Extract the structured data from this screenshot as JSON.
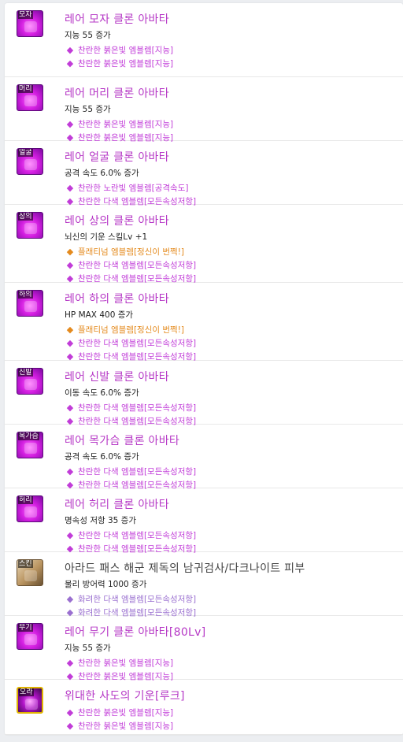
{
  "colors": {
    "rare_title": "#b638c6",
    "pink_emblem": "#c13cd8",
    "orange_emblem": "#e48a1d",
    "violet_emblem": "#9a6fd0"
  },
  "items": [
    {
      "icon": "hat-avatar-icon",
      "slot_tag": "모자",
      "title": "레어 모자 클론 아바타",
      "stat": "지능 55 증가",
      "emblems": [
        {
          "text": "찬란한 붉은빛 엠블렘[지능]",
          "gem": "pink"
        },
        {
          "text": "찬란한 붉은빛 엠블렘[지능]",
          "gem": "pink"
        }
      ]
    },
    {
      "icon": "hair-avatar-icon",
      "slot_tag": "머리",
      "title": "레어 머리 클론 아바타",
      "stat": "지능 55 증가",
      "emblems": [
        {
          "text": "찬란한 붉은빛 엠블렘[지능]",
          "gem": "pink"
        },
        {
          "text": "찬란한 붉은빛 엠블렘[지능]",
          "gem": "pink"
        }
      ]
    },
    {
      "icon": "face-avatar-icon",
      "slot_tag": "얼굴",
      "title": "레어 얼굴 클론 아바타",
      "stat": "공격 속도 6.0% 증가",
      "emblems": [
        {
          "text": "찬란한 노란빛 엠블렘[공격속도]",
          "gem": "pink"
        },
        {
          "text": "찬란한 다색 엠블렘[모든속성저항]",
          "gem": "pink"
        }
      ]
    },
    {
      "icon": "top-avatar-icon",
      "slot_tag": "상의",
      "title": "레어 상의 클론 아바타",
      "stat": "뇌신의 기운 스킬Lv +1",
      "emblems": [
        {
          "text": "플래티넘 엠블렘[정신이 번쩍!]",
          "gem": "orange"
        },
        {
          "text": "찬란한 다색 엠블렘[모든속성저항]",
          "gem": "pink"
        },
        {
          "text": "찬란한 다색 엠블렘[모든속성저항]",
          "gem": "pink"
        }
      ]
    },
    {
      "icon": "bottom-avatar-icon",
      "slot_tag": "하의",
      "title": "레어 하의 클론 아바타",
      "stat": "HP MAX 400 증가",
      "emblems": [
        {
          "text": "플래티넘 엠블렘[정신이 번쩍!]",
          "gem": "orange"
        },
        {
          "text": "찬란한 다색 엠블렘[모든속성저항]",
          "gem": "pink"
        },
        {
          "text": "찬란한 다색 엠블렘[모든속성저항]",
          "gem": "pink"
        }
      ]
    },
    {
      "icon": "shoes-avatar-icon",
      "slot_tag": "신발",
      "title": "레어 신발 클론 아바타",
      "stat": "이동 속도 6.0% 증가",
      "emblems": [
        {
          "text": "찬란한 다색 엠블렘[모든속성저항]",
          "gem": "pink"
        },
        {
          "text": "찬란한 다색 엠블렘[모든속성저항]",
          "gem": "pink"
        }
      ]
    },
    {
      "icon": "neck-avatar-icon",
      "slot_tag": "목가슴",
      "title": "레어 목가슴 클론 아바타",
      "stat": "공격 속도 6.0% 증가",
      "emblems": [
        {
          "text": "찬란한 다색 엠블렘[모든속성저항]",
          "gem": "pink"
        },
        {
          "text": "찬란한 다색 엠블렘[모든속성저항]",
          "gem": "pink"
        }
      ]
    },
    {
      "icon": "belt-avatar-icon",
      "slot_tag": "허리",
      "title": "레어 허리 클론 아바타",
      "stat": "명속성 저항 35 증가",
      "emblems": [
        {
          "text": "찬란한 다색 엠블렘[모든속성저항]",
          "gem": "pink"
        },
        {
          "text": "찬란한 다색 엠블렘[모든속성저항]",
          "gem": "pink"
        }
      ]
    },
    {
      "icon": "skin-avatar-icon",
      "slot_tag": "스킨",
      "title": "아라드 패스 해군 제독의 남귀검사/다크나이트 피부",
      "stat": "물리 방어력 1000 증가",
      "emblems": [
        {
          "text": "화려한 다색 엠블렘[모든속성저항]",
          "gem": "violet"
        },
        {
          "text": "화려한 다색 엠블렘[모든속성저항]",
          "gem": "violet"
        }
      ]
    },
    {
      "icon": "weapon-avatar-icon",
      "slot_tag": "무기",
      "title": "레어 무기 클론 아바타[80Lv]",
      "stat": "지능 55 증가",
      "emblems": [
        {
          "text": "찬란한 붉은빛 엠블렘[지능]",
          "gem": "pink"
        },
        {
          "text": "찬란한 붉은빛 엠블렘[지능]",
          "gem": "pink"
        }
      ]
    },
    {
      "icon": "aura-avatar-icon",
      "slot_tag": "오라",
      "title": "위대한 사도의 기운[루크]",
      "stat": "",
      "emblems": [
        {
          "text": "찬란한 붉은빛 엠블렘[지능]",
          "gem": "pink"
        },
        {
          "text": "찬란한 붉은빛 엠블렘[지능]",
          "gem": "pink"
        }
      ]
    }
  ]
}
